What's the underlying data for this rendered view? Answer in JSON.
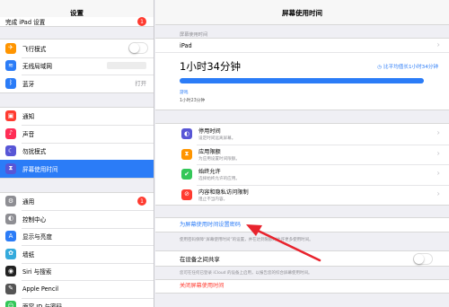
{
  "sidebar": {
    "title": "设置",
    "top_partial": {
      "label": "完成 iPad 设置",
      "badge": "1"
    },
    "group1": [
      {
        "name": "airplane",
        "label": "飞行模式",
        "icon": "✈",
        "color": "#ff9500",
        "type": "toggle"
      },
      {
        "name": "wifi",
        "label": "无线局域网",
        "icon": "≋",
        "color": "#2b7cf7",
        "type": "blur"
      },
      {
        "name": "bluetooth",
        "label": "蓝牙",
        "icon": "ᛒ",
        "color": "#2b7cf7",
        "type": "value",
        "value": "打开"
      }
    ],
    "group2": [
      {
        "name": "notifications",
        "label": "通知",
        "icon": "▣",
        "color": "#ff3b30"
      },
      {
        "name": "sounds",
        "label": "声音",
        "icon": "♪",
        "color": "#ff2d55"
      },
      {
        "name": "do-not-disturb",
        "label": "勿扰模式",
        "icon": "☾",
        "color": "#5856d6"
      },
      {
        "name": "screen-time",
        "label": "屏幕使用时间",
        "icon": "⧗",
        "color": "#5856d6",
        "selected": true
      }
    ],
    "group3": [
      {
        "name": "general",
        "label": "通用",
        "icon": "⚙",
        "color": "#8e8e93",
        "badge": "1"
      },
      {
        "name": "control-center",
        "label": "控制中心",
        "icon": "◐",
        "color": "#8e8e93"
      },
      {
        "name": "display",
        "label": "显示与亮度",
        "icon": "A",
        "color": "#2b7cf7"
      },
      {
        "name": "wallpaper",
        "label": "墙纸",
        "icon": "✿",
        "color": "#34aadc"
      },
      {
        "name": "siri",
        "label": "Siri 与搜索",
        "icon": "◉",
        "color": "#222222"
      },
      {
        "name": "apple-pencil",
        "label": "Apple Pencil",
        "icon": "✎",
        "color": "#555555"
      },
      {
        "name": "face-id",
        "label": "面容 ID 与密码",
        "icon": "☺",
        "color": "#34c759"
      }
    ]
  },
  "detail": {
    "title": "屏幕使用时间",
    "section_label": "屏幕使用时间",
    "device": "iPad",
    "total_time": "1小时34分钟",
    "comparison": "比平均值长1小时34分钟",
    "usage_fraction": 0.95,
    "bar_label": "游戏",
    "bar_sub": "1小时23分钟",
    "options": [
      {
        "name": "downtime",
        "title": "停用时间",
        "sub": "设定时间远离屏幕。",
        "icon": "◐",
        "color": "#5856d6"
      },
      {
        "name": "app-limits",
        "title": "应用限额",
        "sub": "为应用设置时间限额。",
        "icon": "⧗",
        "color": "#ff9500"
      },
      {
        "name": "always-allowed",
        "title": "始终允许",
        "sub": "选择始终允许的应用。",
        "icon": "✔",
        "color": "#34c759"
      },
      {
        "name": "content-privacy",
        "title": "内容和隐私访问限制",
        "sub": "阻止不当内容。",
        "icon": "⊘",
        "color": "#ff3b30"
      }
    ],
    "passcode_link": "为屏幕使用时间设置密码",
    "passcode_note": "使用密码保障“屏幕使用时间”的设置，并在达到限额时允许更多使用时间。",
    "share_label": "在设备之间共享",
    "share_note": "您可在任何已登录 iCloud 的设备上启用，以报告您的综合屏幕使用时间。",
    "turn_off": "关闭屏幕使用时间"
  },
  "accent_color": "#2b7cf7",
  "annotation_color": "#e8232d"
}
